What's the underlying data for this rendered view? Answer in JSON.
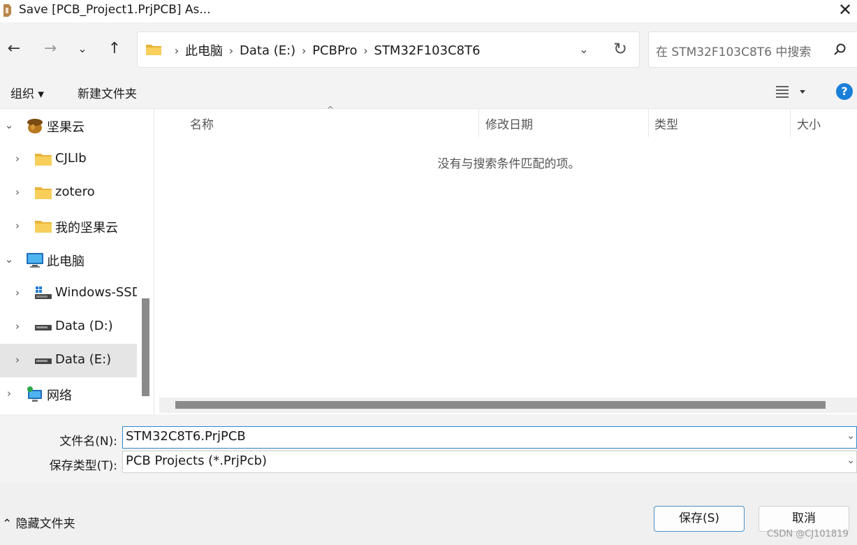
{
  "window": {
    "title": "Save [PCB_Project1.PrjPCB] As...",
    "close_glyph": "✕",
    "app_icon": "altium-designer-icon"
  },
  "nav": {
    "back_glyph": "←",
    "forward_glyph": "→",
    "recent_glyph": "⌄",
    "up_glyph": "↑",
    "breadcrumbs": [
      "此电脑",
      "Data (E:)",
      "PCBPro",
      "STM32F103C8T6"
    ],
    "separator": "›",
    "dropdown_glyph": "⌄",
    "refresh_glyph": "↻",
    "search_placeholder": "在 STM32F103C8T6 中搜索"
  },
  "toolbar": {
    "organize_label": "组织 ▾",
    "new_folder_label": "新建文件夹",
    "help_label": "?"
  },
  "tree": [
    {
      "label": "坚果云",
      "icon": "nut-cloud-icon",
      "expanded": true,
      "level": 0,
      "selected": false
    },
    {
      "label": "CJLIb",
      "icon": "folder-icon",
      "expanded": false,
      "level": 1,
      "selected": false
    },
    {
      "label": "zotero",
      "icon": "folder-icon",
      "expanded": false,
      "level": 1,
      "selected": false
    },
    {
      "label": "我的坚果云",
      "icon": "folder-icon",
      "expanded": false,
      "level": 1,
      "selected": false
    },
    {
      "label": "此电脑",
      "icon": "computer-icon",
      "expanded": true,
      "level": 0,
      "selected": false
    },
    {
      "label": "Windows-SSD",
      "icon": "windows-drive-icon",
      "expanded": false,
      "level": 1,
      "selected": false
    },
    {
      "label": "Data (D:)",
      "icon": "drive-icon",
      "expanded": false,
      "level": 1,
      "selected": false
    },
    {
      "label": "Data (E:)",
      "icon": "drive-icon",
      "expanded": false,
      "level": 1,
      "selected": true
    },
    {
      "label": "网络",
      "icon": "network-icon",
      "expanded": false,
      "level": 0,
      "selected": false
    }
  ],
  "columns": [
    "名称",
    "修改日期",
    "类型",
    "大小"
  ],
  "empty_message": "没有与搜索条件匹配的项。",
  "form": {
    "filename_label": "文件名(N):",
    "filename_value": "STM32C8T6.PrjPCB",
    "filetype_label": "保存类型(T):",
    "filetype_value": "PCB Projects (*.PrjPcb)"
  },
  "footer": {
    "hide_folders_label": "⌃ 隐藏文件夹",
    "save_label": "保存(S)",
    "cancel_label": "取消",
    "watermark": "CSDN @CJ101819"
  }
}
